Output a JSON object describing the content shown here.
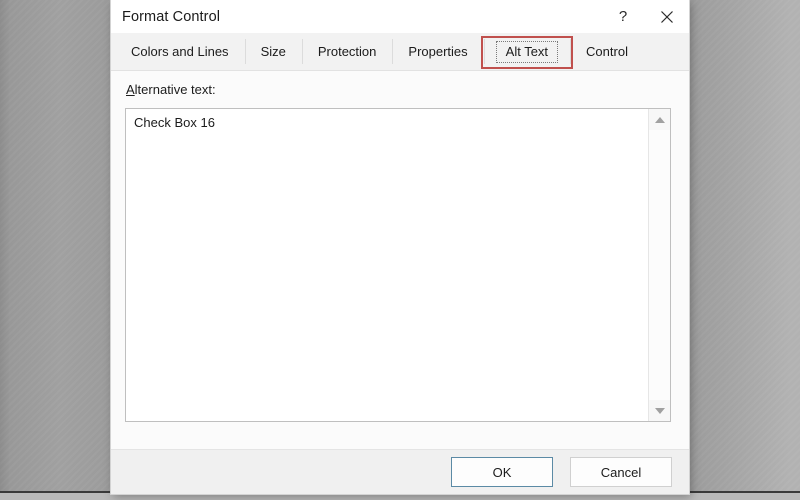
{
  "window": {
    "title": "Format Control",
    "caption_buttons": [
      {
        "name": "help-button",
        "glyph": "?"
      },
      {
        "name": "close-button",
        "glyph": "✕"
      }
    ]
  },
  "tabs": [
    {
      "label": "Colors and Lines",
      "selected": false
    },
    {
      "label": "Size",
      "selected": false
    },
    {
      "label": "Protection",
      "selected": false
    },
    {
      "label": "Properties",
      "selected": false
    },
    {
      "label": "Alt Text",
      "selected": true
    },
    {
      "label": "Control",
      "selected": false
    }
  ],
  "highlight": {
    "color": "#c0504d",
    "target_tab": "Alt Text"
  },
  "alt_text_pane": {
    "label_accel": "A",
    "label_rest": "lternative text:",
    "textarea": {
      "value": "Check Box 16",
      "placeholder": ""
    },
    "scrollbar": {
      "up_icon": "scroll-up-arrow-icon",
      "down_icon": "scroll-down-arrow-icon"
    }
  },
  "footer": {
    "ok_label": "OK",
    "cancel_label": "Cancel"
  },
  "colors": {
    "accent_default_button_border": "#5b8aa5",
    "highlight_red": "#c0504d",
    "dialog_background": "#f0f0f0",
    "pane_background": "#fbfbfb",
    "desktop_gray": "#9d9d9d"
  }
}
